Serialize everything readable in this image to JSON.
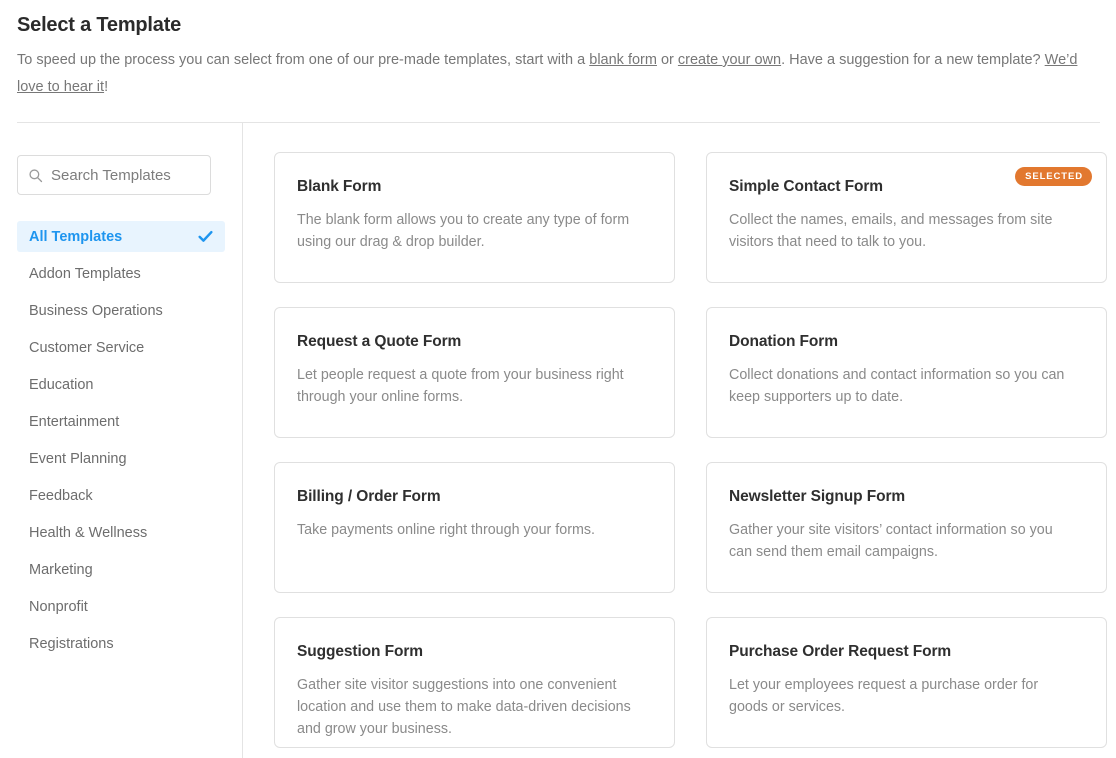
{
  "header": {
    "title": "Select a Template",
    "subtitle_parts": [
      {
        "type": "text",
        "text": "To speed up the process you can select from one of our pre-made templates, start with a "
      },
      {
        "type": "link",
        "text": "blank form",
        "name": "blank-form-link"
      },
      {
        "type": "text",
        "text": " or "
      },
      {
        "type": "link",
        "text": "create your own",
        "name": "create-your-own-link"
      },
      {
        "type": "text",
        "text": ". Have a suggestion for a new template? "
      },
      {
        "type": "link",
        "text": "We’d love to hear it",
        "name": "feedback-link"
      },
      {
        "type": "text",
        "text": "!"
      }
    ],
    "subtitle_plain": "To speed up the process you can select from one of our pre-made templates, start with a blank form or create your own. Have a suggestion for a new template? We’d love to hear it!"
  },
  "sidebar": {
    "search": {
      "placeholder": "Search Templates",
      "value": "",
      "icon": "search-icon"
    },
    "selected_category": "All Templates",
    "check_icon": "check-icon",
    "items": [
      {
        "label": "All Templates",
        "active": true
      },
      {
        "label": "Addon Templates",
        "active": false
      },
      {
        "label": "Business Operations",
        "active": false
      },
      {
        "label": "Customer Service",
        "active": false
      },
      {
        "label": "Education",
        "active": false
      },
      {
        "label": "Entertainment",
        "active": false
      },
      {
        "label": "Event Planning",
        "active": false
      },
      {
        "label": "Feedback",
        "active": false
      },
      {
        "label": "Health & Wellness",
        "active": false
      },
      {
        "label": "Marketing",
        "active": false
      },
      {
        "label": "Nonprofit",
        "active": false
      },
      {
        "label": "Registrations",
        "active": false
      }
    ]
  },
  "templates": {
    "selected_badge_label": "SELECTED",
    "cards": [
      {
        "title": "Blank Form",
        "description": "The blank form allows you to create any type of form using our drag & drop builder.",
        "selected": false
      },
      {
        "title": "Simple Contact Form",
        "description": "Collect the names, emails, and messages from site visitors that need to talk to you.",
        "selected": true
      },
      {
        "title": "Request a Quote Form",
        "description": "Let people request a quote from your business right through your online forms.",
        "selected": false
      },
      {
        "title": "Donation Form",
        "description": "Collect donations and contact information so you can keep supporters up to date.",
        "selected": false
      },
      {
        "title": "Billing / Order Form",
        "description": "Take payments online right through your forms.",
        "selected": false
      },
      {
        "title": "Newsletter Signup Form",
        "description": "Gather your site visitors’ contact information so you can send them email campaigns.",
        "selected": false
      },
      {
        "title": "Suggestion Form",
        "description": "Gather site visitor suggestions into one convenient location and use them to make data-driven decisions and grow your business.",
        "selected": false
      },
      {
        "title": "Purchase Order Request Form",
        "description": "Let your employees request a purchase order for goods or services.",
        "selected": false
      }
    ]
  },
  "colors": {
    "accent_blue": "#1e95ef",
    "active_bg": "#e8f4fe",
    "badge_orange": "#e2782f",
    "border": "#e0e0e0",
    "title_text": "#2f2f2f",
    "muted_text": "#8a8a8a"
  }
}
